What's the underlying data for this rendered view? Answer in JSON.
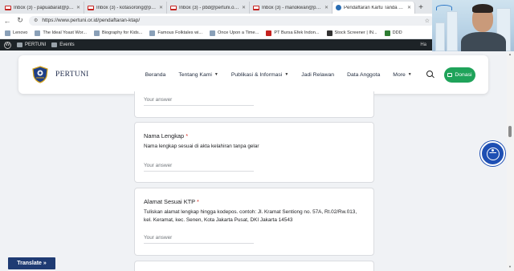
{
  "browser": {
    "tabs": [
      {
        "title": "Inbox (3) - papuabarat@pertu",
        "active": false
      },
      {
        "title": "Inbox (3) - kotasorong@pertu",
        "active": false
      },
      {
        "title": "Inbox (3) - pbd@pertuni.or.id",
        "active": false
      },
      {
        "title": "Inbox (3) - manokwari@pertu",
        "active": false
      },
      {
        "title": "Pendaftaran Kartu Tanda Angg",
        "active": true
      }
    ],
    "url": "https://www.pertuni.or.id/pendaftaran-ktap/",
    "bookmarks": [
      "Lenovo",
      "The Ideal Yoast Wor...",
      "Biography for Kids...",
      "Famous Folktales wi...",
      "Once Upon a Time...",
      "PT Bursa Efek Indon...",
      "Stock Screener | IN...",
      "DDD"
    ]
  },
  "wp_admin": {
    "site": "PERTUNI",
    "events": "Events",
    "greeting": "Ha"
  },
  "site": {
    "brand": "PERTUNI",
    "nav": [
      {
        "label": "Beranda",
        "dropdown": false
      },
      {
        "label": "Tentang Kami",
        "dropdown": true
      },
      {
        "label": "Publikasi & Informasi",
        "dropdown": true
      },
      {
        "label": "Jadi Relawan",
        "dropdown": false
      },
      {
        "label": "Data Anggota",
        "dropdown": false
      },
      {
        "label": "More",
        "dropdown": true
      }
    ],
    "cta": "Donasi",
    "accent": "#1fa35a",
    "brand_color": "#1e2a4a"
  },
  "form": {
    "answer_placeholder": "Your answer",
    "nama_lengkap": {
      "question": "Nama Lengkap",
      "required_mark": "*",
      "description": "Nama lengkap sesuai di akta kelahiran tanpa gelar"
    },
    "alamat": {
      "question": "Alamat Sesuai KTP",
      "required_mark": "*",
      "description": "Tuliskan alamat lengkap hingga kodepos. contoh: Jl. Kramat Sentiong no. 57A, Rt.02/Rw.013, kel. Keramat, kec. Senen, Kota Jakarta Pusat, DKI Jakarta 14543"
    }
  },
  "translate_label": "Translate »",
  "accessibility_icon": "accessibility-icon"
}
